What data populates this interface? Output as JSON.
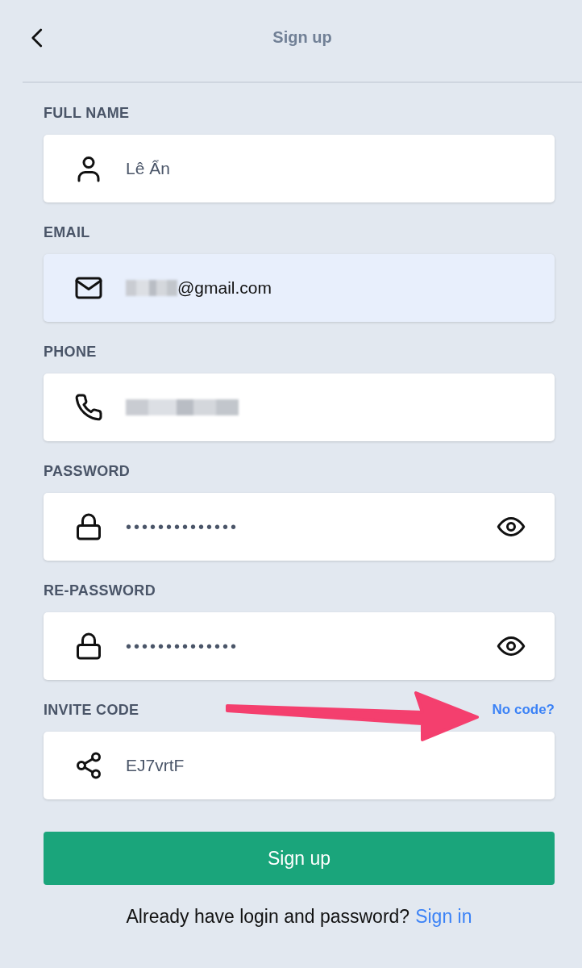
{
  "header": {
    "title": "Sign up"
  },
  "fields": [
    {
      "kind": "name",
      "label": "FULL NAME",
      "value": "Lê Ẩn",
      "autofilled": false,
      "redacted": false
    },
    {
      "kind": "email",
      "label": "EMAIL",
      "value": "@gmail.com",
      "autofilled": true,
      "redacted": true
    },
    {
      "kind": "phone",
      "label": "PHONE",
      "autofilled": false,
      "redacted": true
    },
    {
      "kind": "password",
      "label": "PASSWORD",
      "value": "••••••••••••••",
      "autofilled": false,
      "redacted": false,
      "reveal_toggle": true
    },
    {
      "kind": "password",
      "label": "RE-PASSWORD",
      "value": "••••••••••••••",
      "autofilled": false,
      "redacted": false,
      "reveal_toggle": true
    },
    {
      "kind": "invite",
      "label": "INVITE CODE",
      "value": "EJ7vrtF",
      "autofilled": false,
      "redacted": false,
      "link": "No code?",
      "annotated": true
    }
  ],
  "submit": "Sign up",
  "footer": {
    "text": "Already have login and password?",
    "link": "Sign in"
  }
}
